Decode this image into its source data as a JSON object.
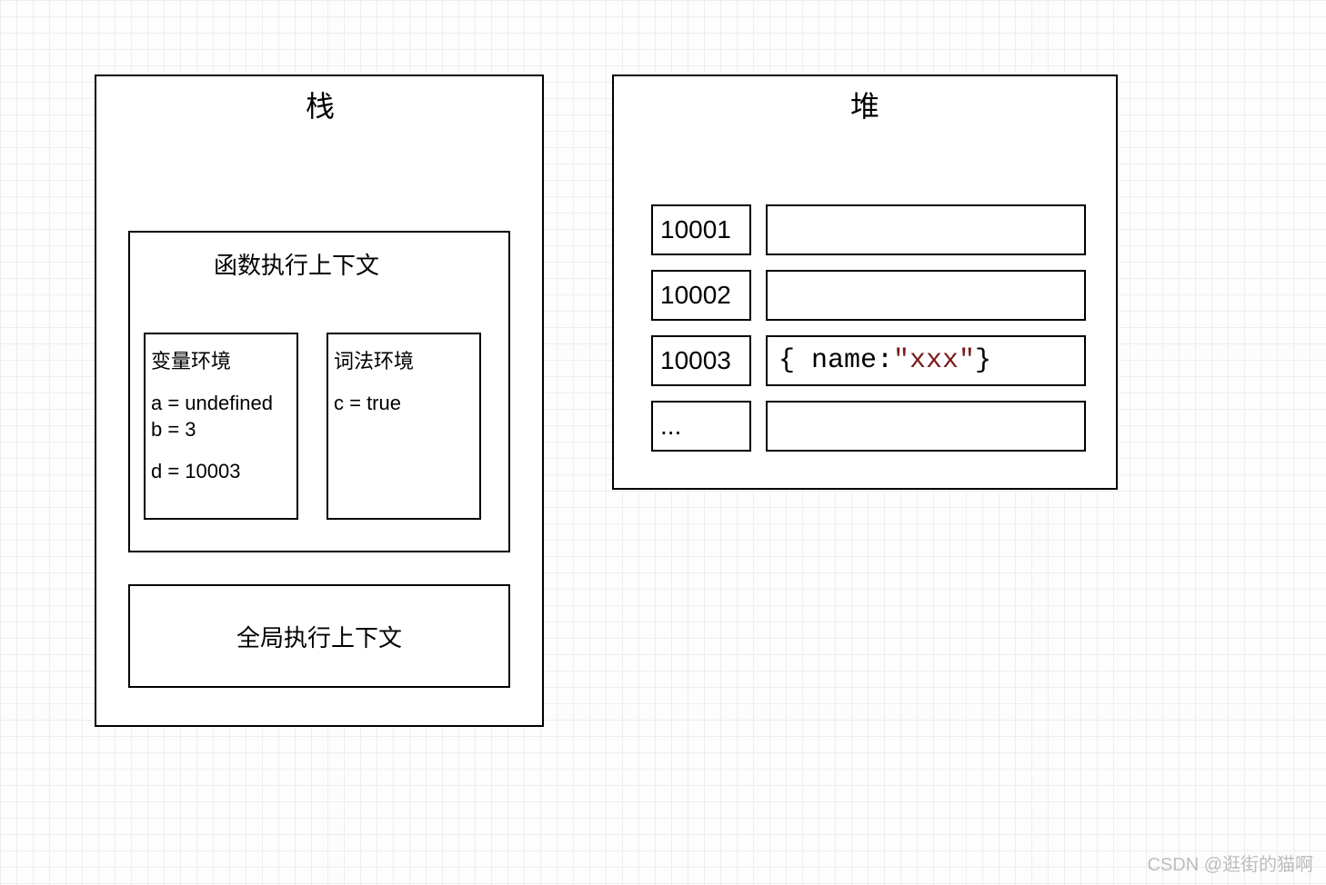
{
  "stack": {
    "title": "栈",
    "funcContext": {
      "title": "函数执行上下文",
      "varEnv": {
        "label": "变量环境",
        "a": "a = undefined",
        "b": "b = 3",
        "d": "d = 10003"
      },
      "lexEnv": {
        "label": "词法环境",
        "c": "c = true"
      }
    },
    "globalContext": {
      "title": "全局执行上下文"
    }
  },
  "heap": {
    "title": "堆",
    "rows": {
      "r0": {
        "addr": "10001",
        "val": ""
      },
      "r1": {
        "addr": "10002",
        "val": ""
      },
      "r2": {
        "addr": "10003",
        "prefix": "{  name: ",
        "str": "\"xxx\"",
        "suffix": "  }"
      },
      "r3": {
        "addr": "...",
        "val": ""
      }
    }
  },
  "watermark": "CSDN @逛街的猫啊"
}
